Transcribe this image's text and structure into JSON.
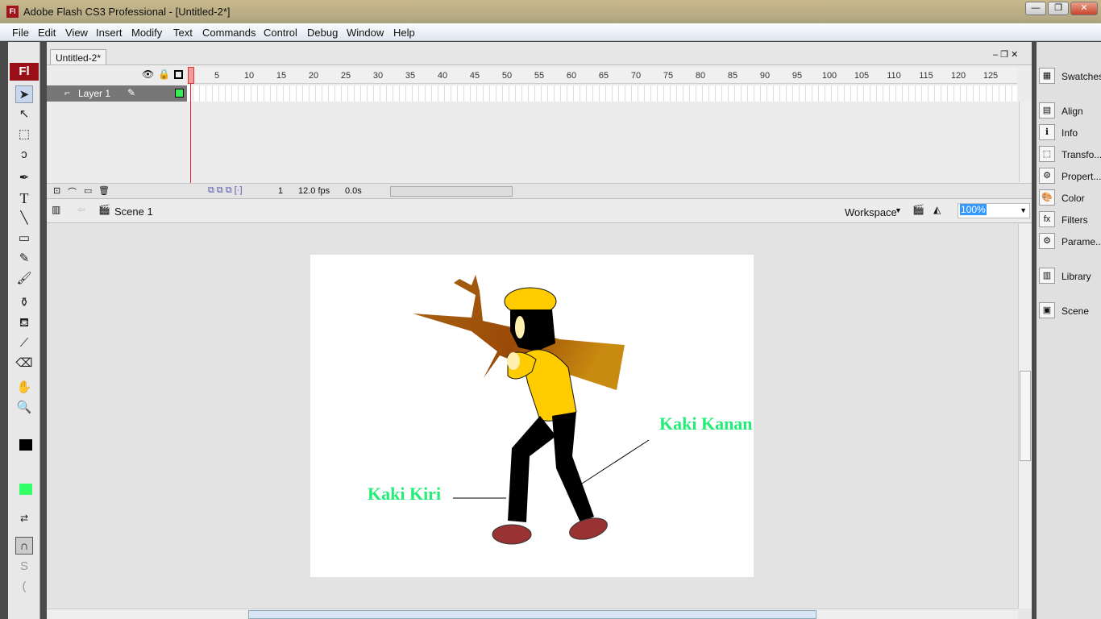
{
  "window": {
    "title": "Adobe Flash CS3 Professional - [Untitled-2*]",
    "app_icon": "Fl",
    "buttons": [
      "minimize",
      "restore",
      "close"
    ]
  },
  "menu": [
    "File",
    "Edit",
    "View",
    "Insert",
    "Modify",
    "Text",
    "Commands",
    "Control",
    "Debug",
    "Window",
    "Help"
  ],
  "toolbox": {
    "logo": "Fl",
    "tools": [
      "selection-tool",
      "subselection-tool",
      "free-transform-tool",
      "lasso-tool",
      "pen-tool",
      "text-tool",
      "line-tool",
      "rectangle-tool",
      "pencil-tool",
      "brush-tool",
      "ink-bottle-tool",
      "paint-bucket-tool",
      "eyedropper-tool",
      "eraser-tool",
      "hand-tool",
      "zoom-tool"
    ],
    "stroke_color": "#000000",
    "fill_color": "#33ff66"
  },
  "document": {
    "tab": "Untitled-2*"
  },
  "timeline": {
    "frame_numbers": [
      1,
      5,
      10,
      15,
      20,
      25,
      30,
      35,
      40,
      45,
      50,
      55,
      60,
      65,
      70,
      75,
      80,
      85,
      90,
      95,
      100,
      105,
      110,
      115,
      120,
      125
    ],
    "layer_name": "Layer 1",
    "layer_color": "#33ee55",
    "current_frame": "1",
    "fps": "12.0 fps",
    "time": "0.0s"
  },
  "editbar": {
    "scene": "Scene 1",
    "workspace": "Workspace",
    "zoom": "100%"
  },
  "stage": {
    "labels": {
      "right_leg": "Kaki Kanan",
      "left_leg": "Kaki Kiri"
    },
    "label_color": "#22ee77"
  },
  "panels": [
    "Swatches",
    "Align",
    "Info",
    "Transfo...",
    "Propert...",
    "Color",
    "Filters",
    "Parame...",
    "Library",
    "Scene"
  ]
}
